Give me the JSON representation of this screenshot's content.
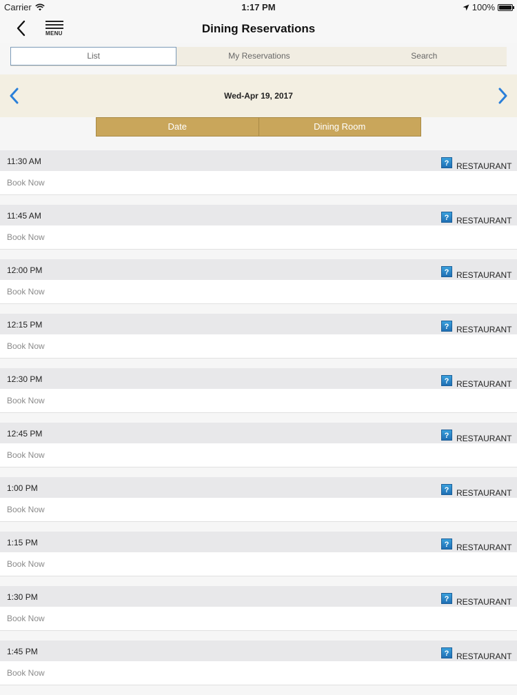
{
  "status_bar": {
    "carrier": "Carrier",
    "time": "1:17 PM",
    "battery": "100%",
    "battery_level": 1.0
  },
  "nav": {
    "title": "Dining Reservations",
    "menu_label": "MENU"
  },
  "tabs": [
    {
      "label": "List",
      "active": true
    },
    {
      "label": "My Reservations",
      "active": false
    },
    {
      "label": "Search",
      "active": false
    }
  ],
  "date_bar": {
    "date": "Wed-Apr 19, 2017"
  },
  "sort": {
    "date_label": "Date",
    "dining_room_label": "Dining Room"
  },
  "slots": [
    {
      "time": "11:30 AM",
      "room": "RESTAURANT",
      "action": "Book Now"
    },
    {
      "time": "11:45 AM",
      "room": "RESTAURANT",
      "action": "Book Now"
    },
    {
      "time": "12:00 PM",
      "room": "RESTAURANT",
      "action": "Book Now"
    },
    {
      "time": "12:15 PM",
      "room": "RESTAURANT",
      "action": "Book Now"
    },
    {
      "time": "12:30 PM",
      "room": "RESTAURANT",
      "action": "Book Now"
    },
    {
      "time": "12:45 PM",
      "room": "RESTAURANT",
      "action": "Book Now"
    },
    {
      "time": "1:00 PM",
      "room": "RESTAURANT",
      "action": "Book Now"
    },
    {
      "time": "1:15 PM",
      "room": "RESTAURANT",
      "action": "Book Now"
    },
    {
      "time": "1:30 PM",
      "room": "RESTAURANT",
      "action": "Book Now"
    },
    {
      "time": "1:45 PM",
      "room": "RESTAURANT",
      "action": "Book Now"
    }
  ],
  "icons": {
    "back": "chevron-left-icon",
    "menu": "hamburger-menu-icon",
    "prev_date": "chevron-left-icon",
    "next_date": "chevron-right-icon",
    "info": "question-mark-icon",
    "wifi": "wifi-icon",
    "location": "location-arrow-icon",
    "battery": "battery-icon"
  },
  "colors": {
    "accent_gold": "#c9a65b",
    "arrow_blue": "#2a7fd9",
    "tab_border": "#7b9ab8",
    "info_icon_blue": "#2a86cc"
  }
}
